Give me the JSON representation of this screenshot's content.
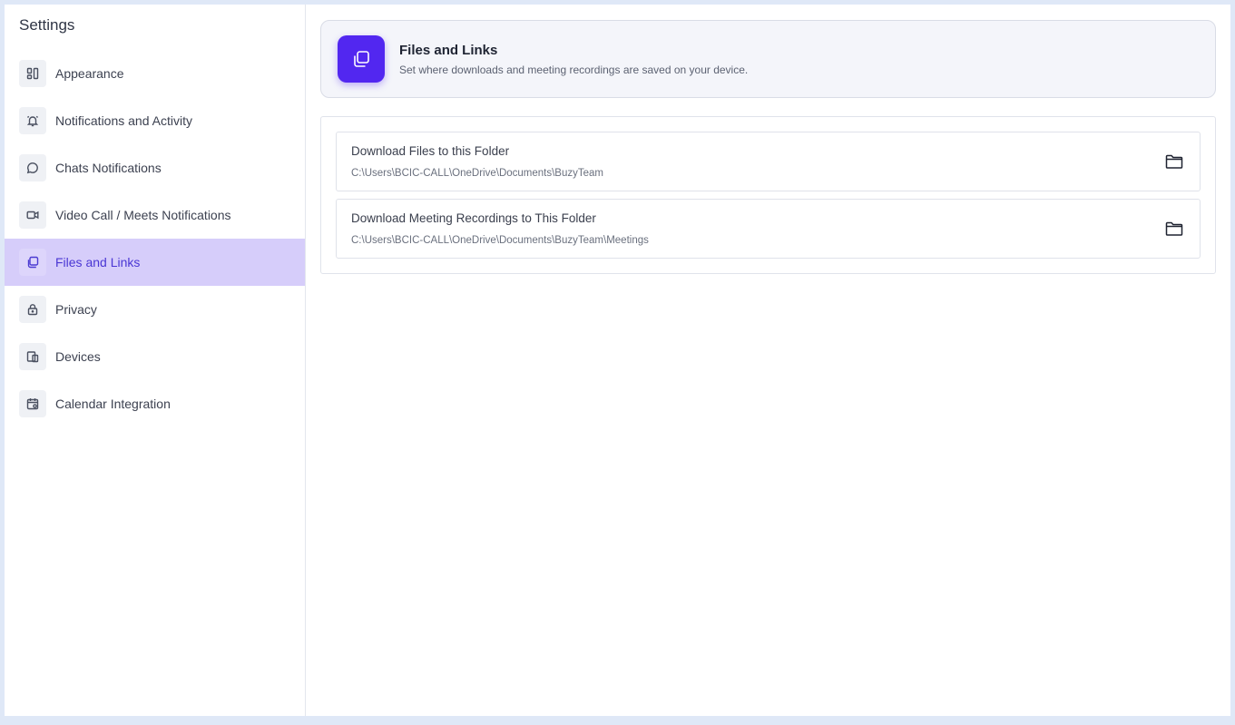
{
  "sidebar": {
    "title": "Settings",
    "items": [
      {
        "label": "Appearance",
        "icon": "layout-icon"
      },
      {
        "label": "Notifications and Activity",
        "icon": "bell-icon"
      },
      {
        "label": "Chats Notifications",
        "icon": "chat-bubble-icon"
      },
      {
        "label": "Video Call / Meets Notifications",
        "icon": "video-camera-icon"
      },
      {
        "label": "Files and Links",
        "icon": "copy-files-icon",
        "active": true
      },
      {
        "label": "Privacy",
        "icon": "lock-icon"
      },
      {
        "label": "Devices",
        "icon": "devices-icon"
      },
      {
        "label": "Calendar Integration",
        "icon": "calendar-icon"
      }
    ]
  },
  "header": {
    "title": "Files and Links",
    "subtitle": "Set where downloads and meeting recordings are saved on your device.",
    "icon": "copy-files-icon"
  },
  "folders": [
    {
      "label": "Download Files to this Folder",
      "path": "C:\\Users\\BCIC-CALL\\OneDrive\\Documents\\BuzyTeam",
      "icon": "folder-icon"
    },
    {
      "label": "Download Meeting Recordings to This Folder",
      "path": "C:\\Users\\BCIC-CALL\\OneDrive\\Documents\\BuzyTeam\\Meetings",
      "icon": "folder-icon"
    }
  ],
  "colors": {
    "accent": "#5227f0",
    "active_bg": "#d6cdfa",
    "page_bg": "#dfe8f7"
  }
}
